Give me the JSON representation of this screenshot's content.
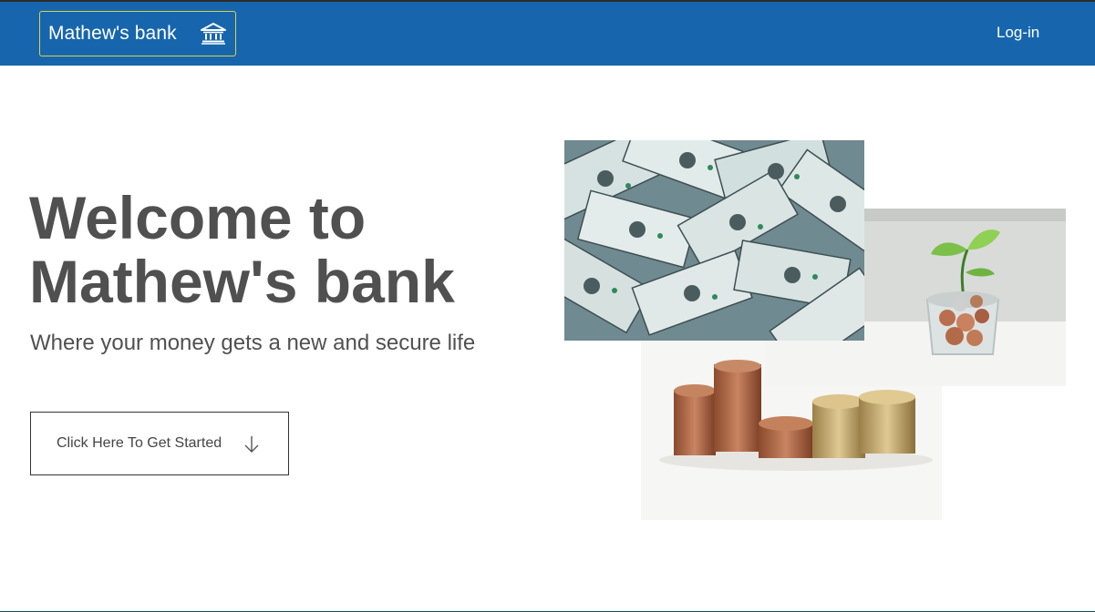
{
  "nav": {
    "brand_label": "Mathew's bank",
    "brand_icon": "bank-icon",
    "login_label": "Log-in",
    "bar_color": "#1766ad",
    "brand_border_color": "#d8d24a"
  },
  "hero": {
    "title_line1": "Welcome to",
    "title_line2": "Mathew's bank",
    "subtitle": "Where your money gets a new and secure life",
    "cta_label": "Click Here To Get Started",
    "cta_icon": "arrow-down-icon",
    "text_color": "#505050"
  },
  "images": [
    {
      "name": "banknotes-image",
      "subject": "scattered one-dollar bills"
    },
    {
      "name": "plant-coins-image",
      "subject": "seedling growing in a glass of coins"
    },
    {
      "name": "coin-stacks-image",
      "subject": "stacks of copper and gold coins"
    }
  ]
}
